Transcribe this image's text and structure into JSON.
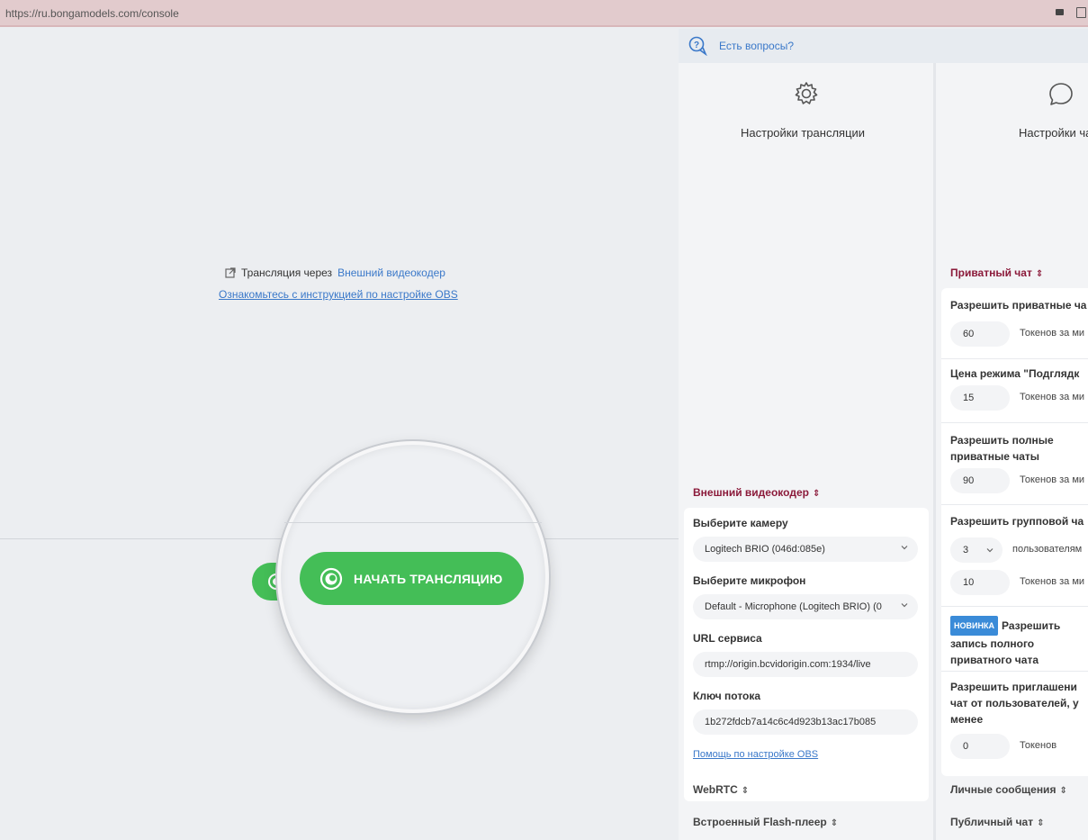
{
  "browser": {
    "url": "https://ru.bongamodels.com/console"
  },
  "stage": {
    "encoder_prefix": "Трансляция через",
    "encoder_link": "Внешний видеокодер",
    "obs_instructions_link": "Ознакомьтесь с инструкцией по настройке OBS",
    "start_button_label": "НАЧАТЬ ТРАНСЛЯЦИЮ"
  },
  "panel": {
    "questions_link": "Есть вопросы?",
    "col_broadcast": {
      "title": "Настройки трансляции",
      "icon": "gear-icon"
    },
    "col_chat": {
      "title": "Настройки ча",
      "icon": "chat-bubble-icon"
    },
    "encoder_section": {
      "title": "Внешний видеокодер",
      "camera_label": "Выберите камеру",
      "camera_value": "Logitech BRIO (046d:085e)",
      "mic_label": "Выберите микрофон",
      "mic_value": "Default - Microphone (Logitech BRIO) (0",
      "url_label": "URL сервиса",
      "url_value": "rtmp://origin.bcvidorigin.com:1934/live",
      "key_label": "Ключ потока",
      "key_value": "1b272fdcb7a14c6c4d923b13ac17b085",
      "help_link": "Помощь по настройке OBS"
    },
    "collapsed_left": [
      "WebRTC",
      "Встроенный Flash-плеер"
    ],
    "private_section": {
      "title": "Приватный чат",
      "rows": [
        {
          "label": "Разрешить приватные ча",
          "value": "60",
          "unit": "Токенов за ми"
        },
        {
          "label": "Цена режима \"Подглядк",
          "value": "15",
          "unit": "Токенов за ми"
        },
        {
          "label": "Разрешить полные приватные чаты",
          "value": "90",
          "unit": "Токенов за ми"
        },
        {
          "label": "Разрешить групповой ча",
          "select_value": "3",
          "select_unit": "пользователям",
          "value": "10",
          "unit": "Токенов за ми"
        },
        {
          "badge": "НОВИНКА",
          "label": "Разрешить запись полного приватного чата"
        },
        {
          "label": "Разрешить приглашени чат от пользователей, у менее",
          "value": "0",
          "unit": "Токенов"
        }
      ]
    },
    "collapsed_right": [
      "Личные сообщения",
      "Публичный чат"
    ]
  },
  "colors": {
    "accent_green": "#44be57",
    "link_blue": "#3a78c9",
    "section_title": "#8b1a3a",
    "badge_blue": "#3a8bd8"
  }
}
